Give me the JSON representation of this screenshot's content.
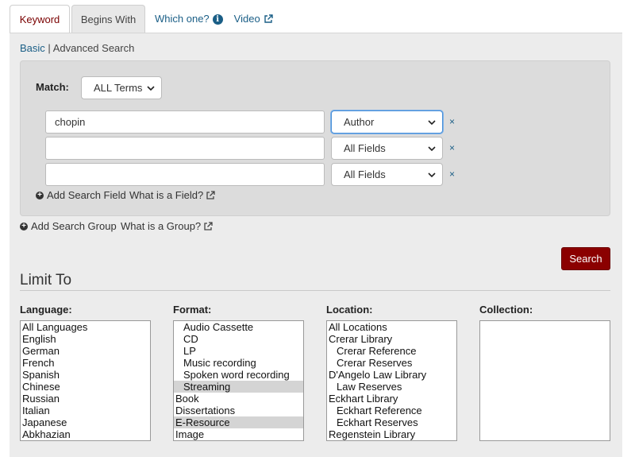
{
  "tabs": {
    "keyword": "Keyword",
    "begins_with": "Begins With",
    "which_one": "Which one?",
    "video": "Video"
  },
  "mode": {
    "basic": "Basic",
    "separator": "|",
    "advanced": "Advanced Search"
  },
  "match": {
    "label": "Match:",
    "value": "ALL Terms"
  },
  "rows": [
    {
      "text": "chopin",
      "field": "Author"
    },
    {
      "text": "",
      "field": "All Fields"
    },
    {
      "text": "",
      "field": "All Fields"
    }
  ],
  "remove_label": "×",
  "add_field": "Add Search Field",
  "what_field": "What is a Field?",
  "add_group": "Add Search Group",
  "what_group": "What is a Group?",
  "search_button": "Search",
  "limit_heading": "Limit To",
  "language": {
    "label": "Language:",
    "options": [
      "All Languages",
      "English",
      "German",
      "French",
      "Spanish",
      "Chinese",
      "Russian",
      "Italian",
      "Japanese",
      "Abkhazian"
    ]
  },
  "format": {
    "label": "Format:",
    "options": [
      {
        "text": "Audio Cassette",
        "indent": true,
        "selected": false
      },
      {
        "text": "CD",
        "indent": true,
        "selected": false
      },
      {
        "text": "LP",
        "indent": true,
        "selected": false
      },
      {
        "text": "Music recording",
        "indent": true,
        "selected": false
      },
      {
        "text": "Spoken word recording",
        "indent": true,
        "selected": false
      },
      {
        "text": "Streaming",
        "indent": true,
        "selected": true
      },
      {
        "text": "Book",
        "indent": false,
        "selected": false
      },
      {
        "text": "Dissertations",
        "indent": false,
        "selected": false
      },
      {
        "text": "E-Resource",
        "indent": false,
        "selected": true
      },
      {
        "text": "Image",
        "indent": false,
        "selected": false
      }
    ]
  },
  "location": {
    "label": "Location:",
    "options": [
      {
        "text": "All Locations",
        "indent": false
      },
      {
        "text": "Crerar Library",
        "indent": false
      },
      {
        "text": "Crerar Reference",
        "indent": true
      },
      {
        "text": "Crerar Reserves",
        "indent": true
      },
      {
        "text": "D'Angelo Law Library",
        "indent": false
      },
      {
        "text": "Law Reserves",
        "indent": true
      },
      {
        "text": "Eckhart Library",
        "indent": false
      },
      {
        "text": "Eckhart Reference",
        "indent": true
      },
      {
        "text": "Eckhart Reserves",
        "indent": true
      },
      {
        "text": "Regenstein Library",
        "indent": false
      }
    ]
  },
  "collection": {
    "label": "Collection:",
    "options": []
  },
  "colors": {
    "accent": "#8b0000",
    "link": "#1a5e86",
    "panel": "#ececec",
    "selected_option": "#d4d4d4"
  }
}
